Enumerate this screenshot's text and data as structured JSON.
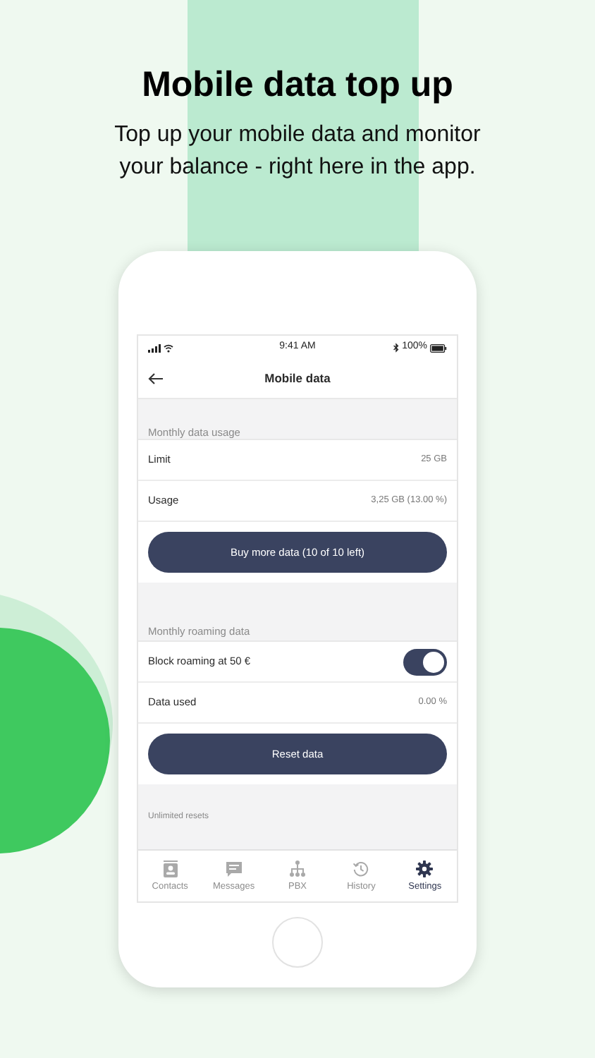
{
  "headline": "Mobile data top up",
  "subtitle": "Top up your mobile data and monitor your balance - right here in the app.",
  "status_bar": {
    "time": "9:41 AM",
    "battery": "100%"
  },
  "nav": {
    "title": "Mobile data"
  },
  "content": [
    {
      "kind": "header",
      "label": "Monthly data usage"
    },
    {
      "kind": "row",
      "label": "Limit",
      "value": "25 GB"
    },
    {
      "kind": "row",
      "label": "Usage",
      "value": "3,25 GB (13.00 %)"
    },
    {
      "kind": "button",
      "label": "Buy more data (10 of 10 left)"
    },
    {
      "kind": "header",
      "label": "Monthly roaming data"
    },
    {
      "kind": "toggle",
      "label": "Block roaming at 50 €",
      "on": true
    },
    {
      "kind": "row",
      "label": "Data used",
      "value": "0.00 %"
    },
    {
      "kind": "button",
      "label": "Reset data"
    },
    {
      "kind": "note",
      "label": "Unlimited resets"
    }
  ],
  "tabs": [
    {
      "label": "Contacts",
      "selected": false
    },
    {
      "label": "Messages",
      "selected": false
    },
    {
      "label": "PBX",
      "selected": false
    },
    {
      "label": "History",
      "selected": false
    },
    {
      "label": "Settings",
      "selected": true
    }
  ]
}
